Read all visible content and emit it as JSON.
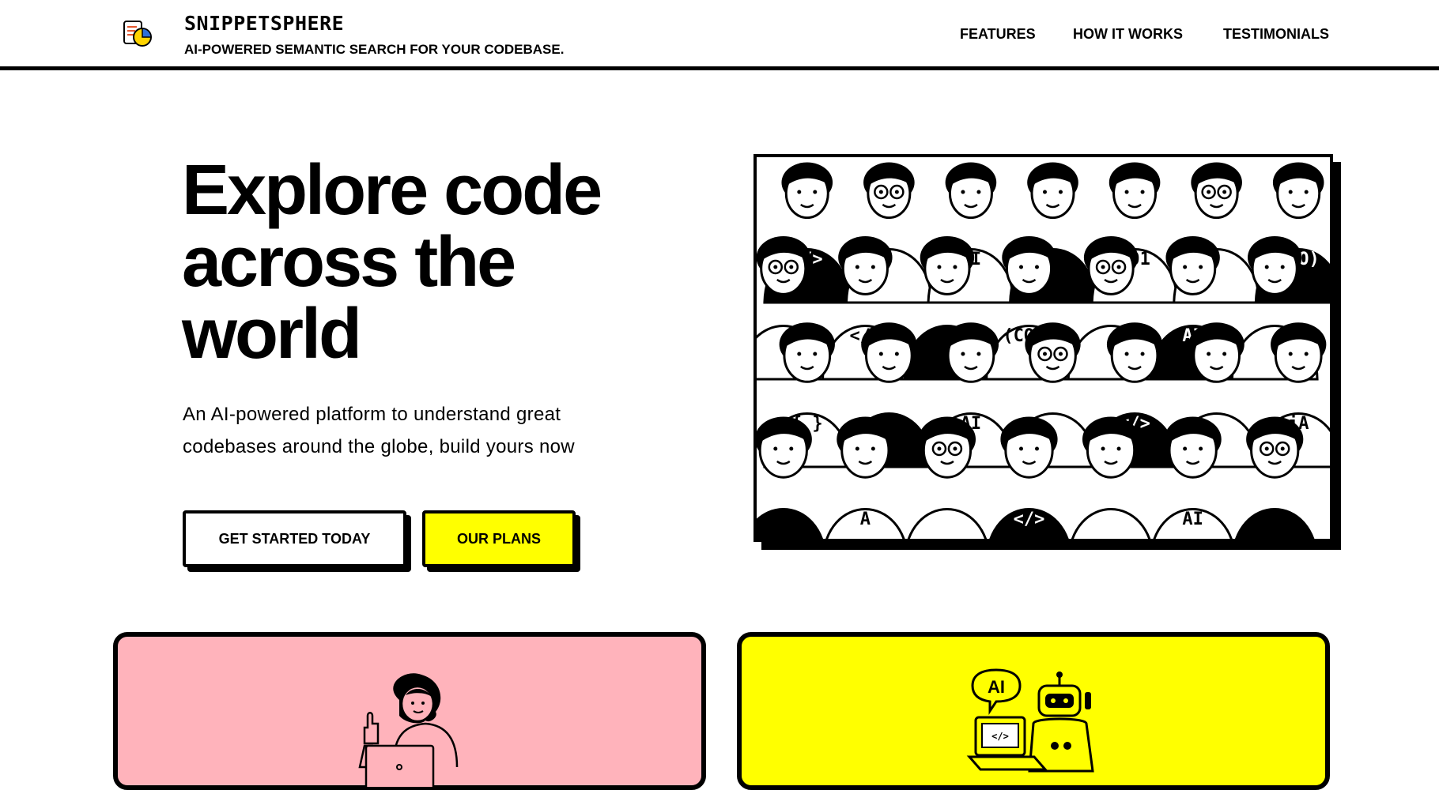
{
  "header": {
    "brand_name": "SNIPPETSPHERE",
    "tagline": "AI-POWERED SEMANTIC SEARCH FOR YOUR CODEBASE.",
    "logo_icon": "document-pie-chart-icon",
    "nav": [
      "FEATURES",
      "HOW IT WORKS",
      "TESTIMONIALS"
    ]
  },
  "hero": {
    "title_lines": [
      "Explore code",
      "across the",
      "world"
    ],
    "subtitle_lines": [
      "An AI-powered platform to understand great",
      "codebases around the globe, build yours now"
    ],
    "primary_button": "GET STARTED TODAY",
    "secondary_button": "OUR PLANS",
    "image": {
      "kind": "crowd-of-developers-illustration",
      "shirt_texts": [
        "</>",
        "AI",
        "101",
        "FOO)",
        "</>",
        "(CODE",
        "AI",
        "{ }",
        "AI",
        "</>",
        "iA",
        "A"
      ]
    }
  },
  "cards": [
    {
      "color": "#ffb3bb",
      "illustration": "woman-laptop-thumbs-up-illustration"
    },
    {
      "color": "#ffff00",
      "illustration": "robot-laptop-ai-illustration",
      "bubble_text": "AI"
    }
  ],
  "colors": {
    "accent": "#ffff00",
    "pink": "#ffb3bb",
    "border": "#000000",
    "background": "#ffffff"
  }
}
